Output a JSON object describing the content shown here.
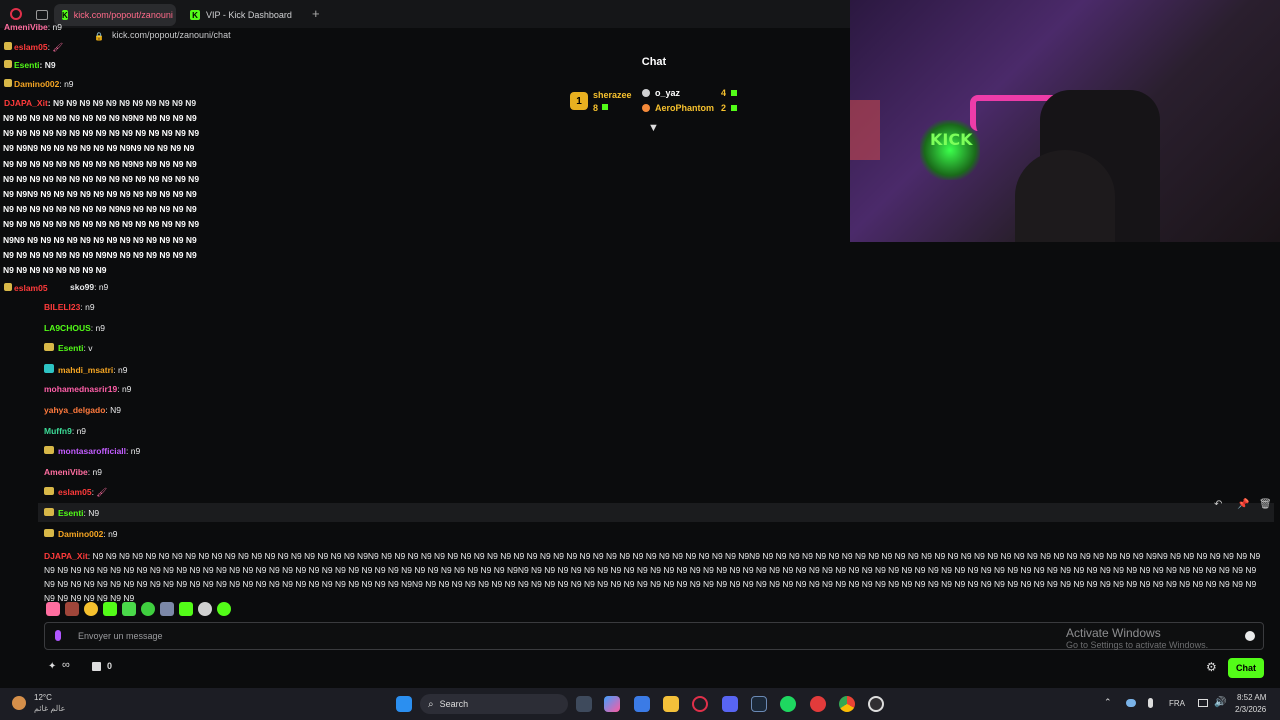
{
  "browser": {
    "active_tab": "kick.com/popout/zanouni",
    "second_tab": "VIP - Kick Dashboard",
    "new_tab": "+",
    "url": "kick.com/popout/zanouni/chat"
  },
  "chat": {
    "title": "Chat",
    "leaderboard": {
      "rank": "1",
      "first_name": "sherazee",
      "first_count": "8",
      "others": [
        {
          "name": "o_yaz",
          "count": "4"
        },
        {
          "name": "AeroPhantom",
          "count": "2"
        }
      ]
    },
    "overlay_messages": [
      {
        "user": "AmeniVibe",
        "text": ": n9"
      },
      {
        "user": "eslam05",
        "text": ":"
      },
      {
        "user": "Esenti",
        "text": ": N9"
      },
      {
        "user": "Damino002",
        "text": ": n9"
      },
      {
        "user": "DJAPA_Xit",
        "text": ": N9 N9 N9 N9 N9 N9 N9 N9 N9 N9 N9"
      }
    ],
    "spam_block": [
      "N9 N9 N9 N9 N9 N9 N9 N9 N9 N9N9 N9 N9 N9 N9",
      "N9 N9 N9 N9 N9 N9 N9 N9 N9 N9 N9 N9 N9 N9 N9",
      "N9 N9N9 N9 N9 N9 N9 N9 N9 N9N9 N9 N9 N9 N9",
      "N9 N9 N9 N9 N9 N9 N9 N9 N9 N9N9 N9 N9 N9 N9",
      "N9 N9 N9 N9 N9 N9 N9 N9 N9 N9 N9 N9 N9 N9 N9",
      "N9 N9N9 N9 N9 N9 N9 N9 N9 N9 N9 N9 N9 N9 N9",
      "N9 N9 N9 N9 N9 N9 N9 N9 N9N9 N9 N9 N9 N9 N9",
      "N9 N9 N9 N9 N9 N9 N9 N9 N9 N9 N9 N9 N9 N9 N9",
      "N9N9 N9 N9 N9 N9 N9 N9 N9 N9 N9 N9 N9 N9 N9",
      "N9 N9 N9 N9 N9 N9 N9 N9N9 N9 N9 N9 N9 N9 N9",
      "N9 N9 N9 N9 N9 N9 N9 N9"
    ],
    "spam_end_user": "eslam05",
    "messages": [
      {
        "user": "sko99",
        "text": ": n9",
        "color": "#e9eaeb",
        "badge": false
      },
      {
        "user": "BILELI23",
        "text": ": n9",
        "color": "#ff3b3b",
        "badge": false
      },
      {
        "user": "LA9CHOUS",
        "text": ": n9",
        "color": "#53fc18",
        "badge": false
      },
      {
        "user": "Esenti",
        "text": ": v",
        "color": "#53fc18",
        "badge": true
      },
      {
        "user": "mahdi_msatri",
        "text": ": n9",
        "color": "#f6a623",
        "badge": true
      },
      {
        "user": "mohamednasrir19",
        "text": ": n9",
        "color": "#ff5fa8",
        "badge": false
      },
      {
        "user": "yahya_delgado",
        "text": ": N9",
        "color": "#ff7a3d",
        "badge": false
      },
      {
        "user": "Muffn9",
        "text": ": n9",
        "color": "#3ddc97",
        "badge": false
      },
      {
        "user": "montasarofficiall",
        "text": ": n9",
        "color": "#c35dff",
        "badge": true
      },
      {
        "user": "AmeniVibe",
        "text": ": n9",
        "color": "#ff6ea0",
        "badge": false
      },
      {
        "user": "eslam05",
        "text": ":",
        "color": "#ff3b3b",
        "badge": true
      },
      {
        "user": "Esenti",
        "text": ": N9",
        "color": "#53fc18",
        "badge": true
      },
      {
        "user": "Damino002",
        "text": ": n9",
        "color": "#f6a623",
        "badge": true
      }
    ],
    "long_message_user": "DJAPA_Xit",
    "long_message_text": ": N9 N9 N9 N9 N9 N9 N9 N9 N9 N9 N9 N9 N9 N9 N9 N9 N9 N9 N9 N9 N9N9 N9 N9 N9 N9 N9 N9 N9 N9 N9 N9 N9 N9 N9 N9 N9 N9 N9 N9 N9 N9 N9 N9 N9 N9 N9 N9 N9 N9N9 N9 N9 N9 N9 N9 N9 N9 N9 N9 N9 N9 N9 N9 N9 N9 N9 N9 N9 N9 N9 N9 N9 N9 N9 N9 N9 N9 N9 N9 N9N9 N9 N9 N9 N9 N9 N9 N9 N9 N9 N9 N9 N9 N9 N9 N9 N9 N9 N9 N9 N9 N9 N9 N9 N9 N9 N9 N9 N9 N9 N9 N9 N9 N9 N9 N9 N9 N9 N9 N9 N9 N9 N9 N9N9 N9 N9 N9 N9 N9 N9 N9 N9 N9 N9 N9 N9 N9 N9 N9 N9 N9 N9 N9 N9 N9 N9 N9 N9 N9 N9 N9 N9 N9 N9 N9 N9 N9 N9 N9 N9 N9 N9 N9 N9 N9 N9 N9 N9 N9 N9 N9 N9 N9 N9 N9 N9 N9 N9 N9 N9 N9 N9 N9 N9 N9 N9 N9 N9 N9 N9 N9 N9 N9 N9 N9 N9 N9 N9 N9 N9 N9 N9 N9 N9 N9 N9 N9N9 N9 N9 N9 N9 N9 N9 N9 N9 N9 N9 N9 N9 N9 N9 N9 N9 N9 N9 N9 N9 N9 N9 N9 N9 N9 N9 N9 N9 N9 N9 N9 N9 N9 N9 N9 N9 N9 N9 N9 N9 N9 N9 N9 N9 N9 N9 N9 N9 N9 N9 N9 N9 N9 N9 N9 N9 N9 N9 N9 N9 N9 N9 N9 N9 N9 N9 N9 N9 N9 N9",
    "input_placeholder": "Envoyer un message",
    "send_label": "Chat",
    "infinity": "∞",
    "count": "0"
  },
  "windows_notice": {
    "title": "Activate Windows",
    "subtitle": "Go to Settings to activate Windows."
  },
  "taskbar": {
    "weather_temp": "12°C",
    "weather_desc": "عالم غائم",
    "search_label": "Search",
    "lang": "FRA",
    "time": "8:52 AM",
    "date": "2/3/2026"
  },
  "colors": {
    "accent": "#53fc18",
    "gold": "#e8b020"
  }
}
